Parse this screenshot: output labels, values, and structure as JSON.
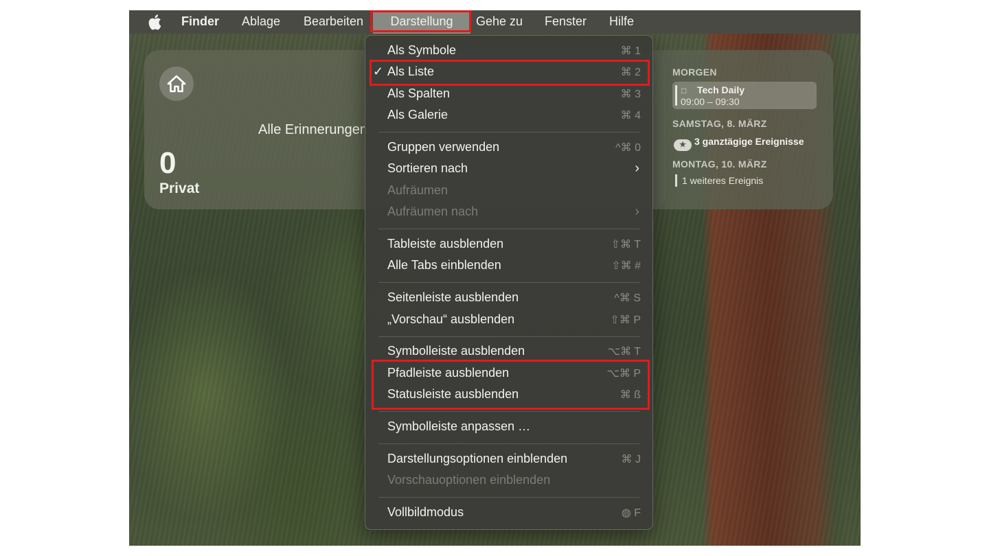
{
  "menubar": {
    "apple": "",
    "items": [
      "Finder",
      "Ablage",
      "Bearbeiten",
      "Darstellung",
      "Gehe zu",
      "Fenster",
      "Hilfe"
    ]
  },
  "reminders": {
    "count": "0",
    "list": "Privat",
    "all_label": "Alle Erinnerungen"
  },
  "calendar": {
    "tomorrow": "MORGEN",
    "event_title": "Tech Daily",
    "event_time": "09:00 – 09:30",
    "saturday": "SAMSTAG, 8. MÄRZ",
    "allday": "3 ganztägige Ereignisse",
    "monday": "MONTAG, 10. MÄRZ",
    "more": "1 weiteres Ereignis"
  },
  "menu": {
    "items": [
      {
        "label": "Als Symbole",
        "shortcut": "⌘ 1"
      },
      {
        "label": "Als Liste",
        "shortcut": "⌘ 2",
        "checked": "✓"
      },
      {
        "label": "Als Spalten",
        "shortcut": "⌘ 3"
      },
      {
        "label": "Als Galerie",
        "shortcut": "⌘ 4"
      },
      {
        "label": "Gruppen verwenden",
        "shortcut": "^⌘ 0"
      },
      {
        "label": "Sortieren nach",
        "arrow": "›"
      },
      {
        "label": "Aufräumen",
        "disabled": true
      },
      {
        "label": "Aufräumen nach",
        "arrow": "›",
        "disabled": true
      },
      {
        "label": "Tableiste ausblenden",
        "shortcut": "⇧⌘ T"
      },
      {
        "label": "Alle Tabs einblenden",
        "shortcut": "⇧⌘ #"
      },
      {
        "label": "Seitenleiste ausblenden",
        "shortcut": "^⌘ S"
      },
      {
        "label": "„Vorschau“ ausblenden",
        "shortcut": "⇧⌘ P"
      },
      {
        "label": "Symbolleiste ausblenden",
        "shortcut": "⌥⌘ T"
      },
      {
        "label": "Pfadleiste ausblenden",
        "shortcut": "⌥⌘ P"
      },
      {
        "label": "Statusleiste ausblenden",
        "shortcut": "⌘ ß"
      },
      {
        "label": "Symbolleiste anpassen …"
      },
      {
        "label": "Darstellungsoptionen einblenden",
        "shortcut": "⌘ J"
      },
      {
        "label": "Vorschauoptionen einblenden",
        "disabled": true
      },
      {
        "label": "Vollbildmodus",
        "shortcut": "◍ F"
      }
    ]
  },
  "colors": {
    "highlight": "#e31b1b",
    "menu_bg": "#3c3c38",
    "menubar_bg": "#4a4a44"
  }
}
